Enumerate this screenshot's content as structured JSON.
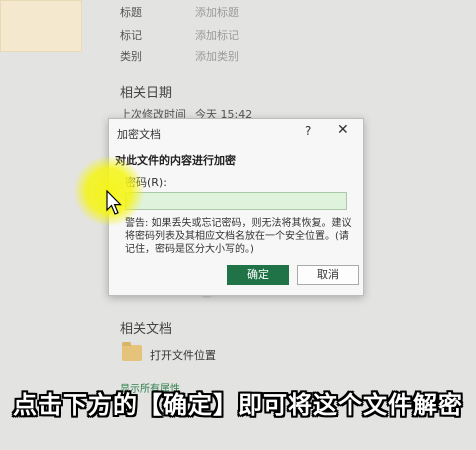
{
  "properties": [
    {
      "label": "标题",
      "value": "添加标题"
    },
    {
      "label": "标记",
      "value": "添加标记"
    },
    {
      "label": "类别",
      "value": "添加类别"
    }
  ],
  "related_dates": {
    "title": "相关日期",
    "last_modified_label": "上次修改时间",
    "last_modified_value": "今天 15:42"
  },
  "related_docs": {
    "title": "相关文档",
    "open_location": "打开文件位置",
    "show_all": "显示所有属性"
  },
  "dialog": {
    "title": "加密文档",
    "help": "?",
    "close": "✕",
    "heading": "对此文件的内容进行加密",
    "password_label": "密码(R):",
    "password_value": "",
    "warning": "警告: 如果丢失或忘记密码，则无法将其恢复。建议将密码列表及其相应文档名放在一个安全位置。(请记住，密码是区分大小写的。)",
    "ok": "确定",
    "cancel": "取消"
  },
  "caption": "点击下方的【确定】即可将这个文件解密",
  "colors": {
    "accent": "#1f7346",
    "input_bg": "#dff2dc",
    "highlight": "#f5f514"
  }
}
